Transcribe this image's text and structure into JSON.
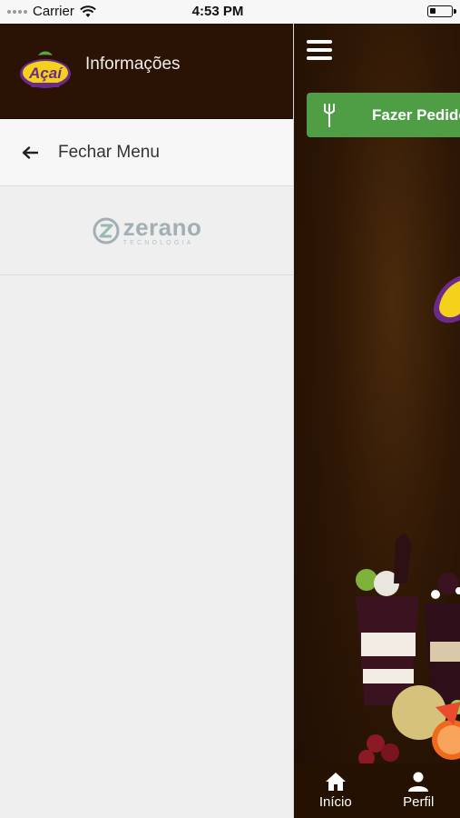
{
  "status_bar": {
    "carrier": "Carrier",
    "time": "4:53 PM"
  },
  "drawer": {
    "title": "Informações",
    "close_label": "Fechar Menu",
    "logo_text": "Açaí",
    "brand_name": "zerano",
    "brand_sub": "TECNOLOGIA"
  },
  "main": {
    "order_button_label": "Fazer Pedido",
    "tabs": [
      {
        "label": "Início",
        "icon": "home-icon"
      },
      {
        "label": "Perfil",
        "icon": "user-icon"
      }
    ]
  },
  "colors": {
    "header": "#2a1305",
    "order_button": "#4f9e46",
    "brand": "#8a9aa2"
  }
}
